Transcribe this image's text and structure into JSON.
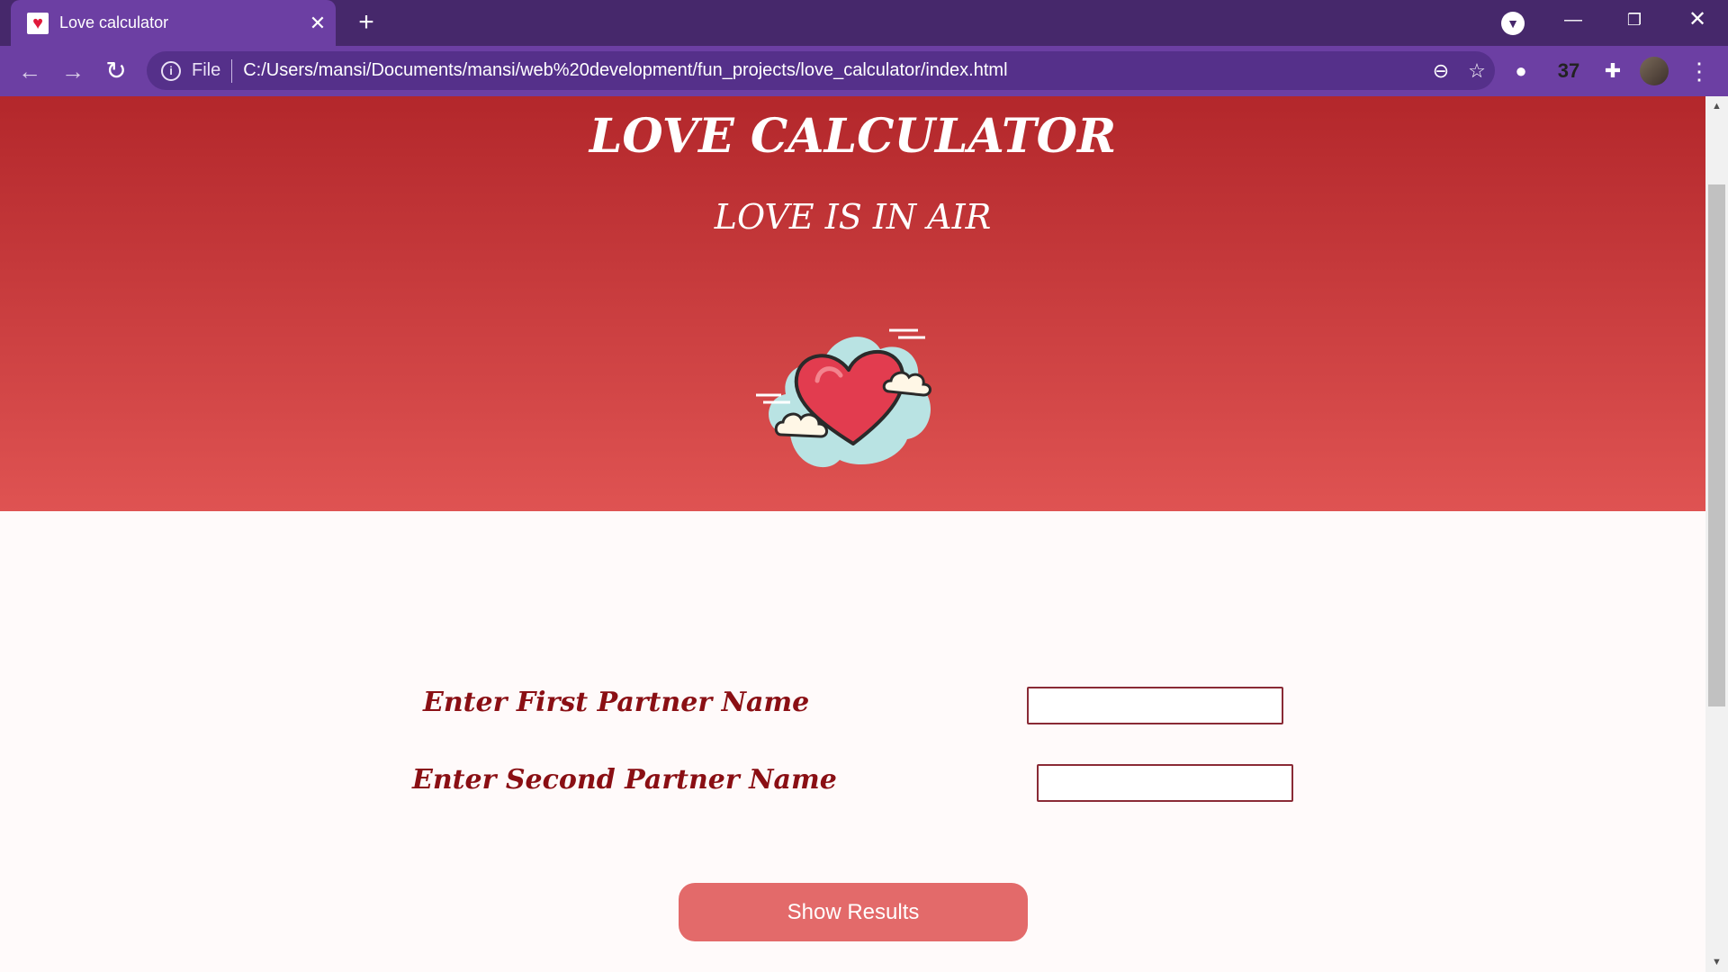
{
  "browser": {
    "tab": {
      "title": "Love calculator",
      "favicon": "heart-favicon-icon",
      "close": "✕"
    },
    "new_tab": "+",
    "omnibox": {
      "scheme_label": "File",
      "url": "C:/Users/mansi/Documents/mansi/web%20development/fun_projects/love_calculator/index.html"
    },
    "extension_count": "37"
  },
  "page": {
    "title": "LOVE CALCULATOR",
    "subtitle": "LOVE IS IN AIR",
    "form": {
      "first_label": "Enter First Partner Name",
      "second_label": "Enter Second Partner Name",
      "first_value": "",
      "second_value": "",
      "submit_label": "Show Results"
    }
  },
  "colors": {
    "chrome_dark": "#46286b",
    "chrome_light": "#6c3fa3",
    "hero_top": "#b3272b",
    "hero_bottom": "#df5352",
    "label": "#8a0f14",
    "button": "#e36a6a",
    "page_bg": "#fffafa"
  }
}
